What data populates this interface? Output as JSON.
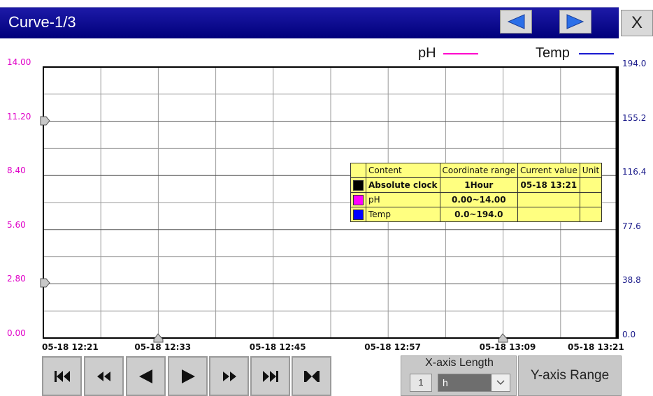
{
  "window": {
    "title": "Curve-1/3",
    "close_label": "X",
    "prev_icon": "left-arrow-icon",
    "next_icon": "right-arrow-icon"
  },
  "legend": {
    "items": [
      {
        "name": "pH",
        "color": "#ff00cc"
      },
      {
        "name": "Temp",
        "color": "#1a1ad0"
      }
    ]
  },
  "colors": {
    "title_bar": "#00008b",
    "left_axis": "#e000c8",
    "right_axis": "#1a1a8a",
    "table_bg": "#ffff80"
  },
  "chart_data": {
    "type": "line",
    "x_labels": [
      "05-18 12:21",
      "05-18 12:33",
      "05-18 12:45",
      "05-18 12:57",
      "05-18 13:09",
      "05-18 13:21"
    ],
    "y_left": {
      "ticks": [
        "14.00",
        "11.20",
        "8.40",
        "5.60",
        "2.80",
        "0.00"
      ],
      "range": [
        0,
        14
      ]
    },
    "y_right": {
      "ticks": [
        "194.0",
        "155.2",
        "116.4",
        "77.6",
        "38.8",
        "0.0"
      ],
      "range": [
        0,
        194
      ]
    },
    "grid": true,
    "series": [
      {
        "name": "pH",
        "values": []
      },
      {
        "name": "Temp",
        "values": []
      }
    ]
  },
  "info_table": {
    "headers": [
      "Content",
      "Coordinate range",
      "Current value",
      "Unit"
    ],
    "rows": [
      {
        "swatch": "#000000",
        "content": "Absolute clock",
        "range": "1Hour",
        "current": "05-18 13:21",
        "unit": ""
      },
      {
        "swatch": "#ff00ff",
        "content": "pH",
        "range": "0.00~14.00",
        "current": "",
        "unit": ""
      },
      {
        "swatch": "#0000ff",
        "content": "Temp",
        "range": "0.0~194.0",
        "current": "",
        "unit": ""
      }
    ]
  },
  "toolbar": {
    "buttons": [
      {
        "name": "first-button",
        "icon": "skip-to-start-icon"
      },
      {
        "name": "fast-back-button",
        "icon": "rewind-icon"
      },
      {
        "name": "back-button",
        "icon": "triangle-left-icon"
      },
      {
        "name": "forward-button",
        "icon": "triangle-right-icon"
      },
      {
        "name": "fast-forward-button",
        "icon": "fast-forward-icon"
      },
      {
        "name": "last-button",
        "icon": "skip-to-end-icon"
      },
      {
        "name": "center-button",
        "icon": "collapse-icon"
      }
    ]
  },
  "x_axis_length": {
    "label": "X-axis Length",
    "value": "1",
    "unit": "h"
  },
  "y_axis_range": {
    "label": "Y-axis Range"
  }
}
